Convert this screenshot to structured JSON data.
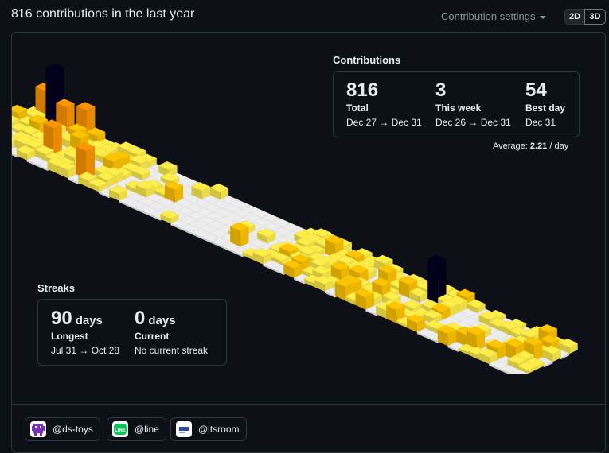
{
  "header": {
    "title": "816 contributions in the last year",
    "settings_label": "Contribution settings",
    "view_2d": "2D",
    "view_3d": "3D"
  },
  "contributions": {
    "title": "Contributions",
    "total": {
      "value": "816",
      "label": "Total",
      "range": "Dec 27 → Dec 31"
    },
    "this_week": {
      "value": "3",
      "label": "This week",
      "range": "Dec 26 → Dec 31"
    },
    "best_day": {
      "value": "54",
      "label": "Best day",
      "range": "Dec 31"
    },
    "average_label": "Average:",
    "average_value": "2.21",
    "average_unit": "/ day"
  },
  "streaks": {
    "title": "Streaks",
    "longest": {
      "value": "90",
      "unit": "days",
      "label": "Longest",
      "range": "Jul 31 → Oct 28"
    },
    "current": {
      "value": "0",
      "unit": "days",
      "label": "Current",
      "range": "No current streak"
    }
  },
  "orgs": [
    {
      "name": "@ds-toys",
      "icon": "ds-toys-icon"
    },
    {
      "name": "@line",
      "icon": "line-icon"
    },
    {
      "name": "@itsroom",
      "icon": "itsroom-icon"
    }
  ],
  "colors": {
    "empty": "#ededed",
    "level1": "#ffee4a",
    "level2": "#ffc501",
    "level3": "#fe9600",
    "level4": "#03001c"
  }
}
